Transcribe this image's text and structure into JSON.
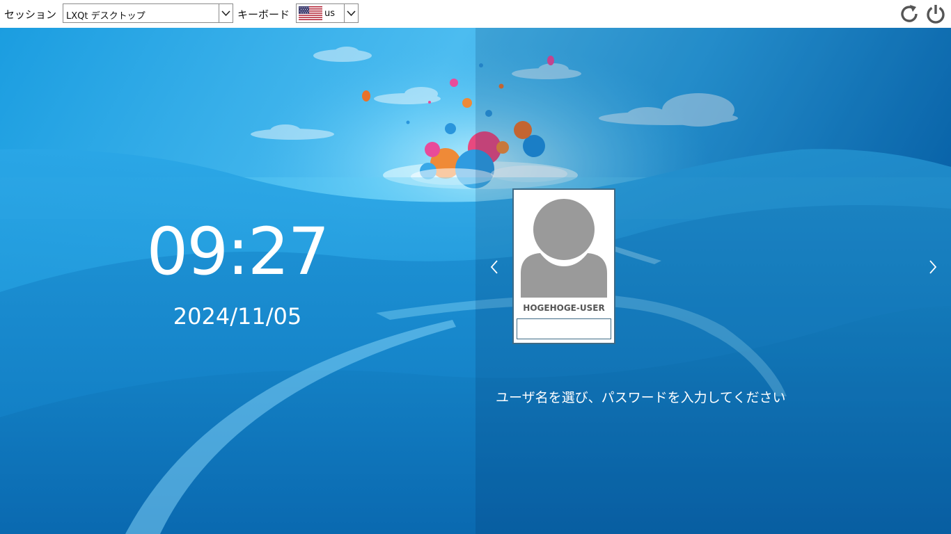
{
  "topbar": {
    "session_label": "セッション",
    "session_value": "LXQt デスクトップ",
    "keyboard_label": "キーボード",
    "keyboard_value": "us"
  },
  "icons": {
    "restart": "restart-icon",
    "power": "power-icon",
    "prev": "chevron-left-icon",
    "next": "chevron-right-icon",
    "flag": "us-flag-icon",
    "avatar": "user-avatar-icon"
  },
  "clock": {
    "time": "09:27",
    "date": "2024/11/05"
  },
  "user": {
    "name": "HOGEHOGE-USER",
    "password_value": ""
  },
  "prompt": "ユーザ名を選び、パスワードを入力してください",
  "colors": {
    "accent": "#3d6a86",
    "avatar_gray": "#9a9a9a"
  }
}
